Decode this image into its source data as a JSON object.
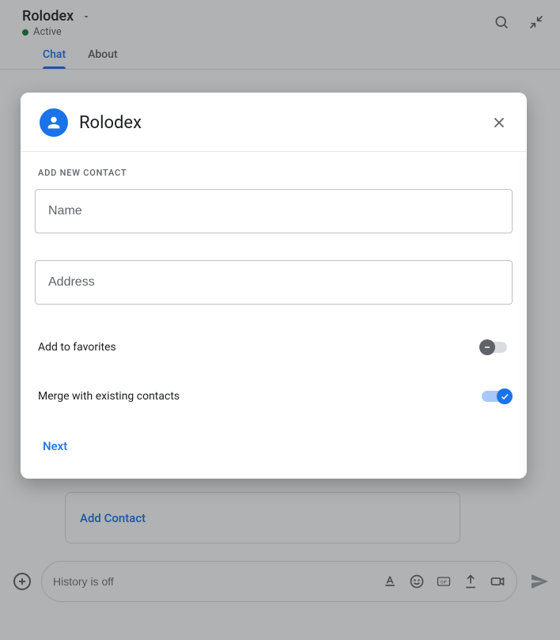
{
  "header": {
    "title": "Rolodex",
    "status": "Active",
    "tabs": [
      {
        "label": "Chat",
        "active": true
      },
      {
        "label": "About",
        "active": false
      }
    ]
  },
  "suggestion": {
    "link_label": "Add Contact"
  },
  "composer": {
    "placeholder": "History is off"
  },
  "dialog": {
    "title": "Rolodex",
    "section_label": "ADD NEW CONTACT",
    "name_placeholder": "Name",
    "name_value": "",
    "address_placeholder": "Address",
    "address_value": "",
    "favorites_label": "Add to favorites",
    "favorites_on": false,
    "merge_label": "Merge with existing contacts",
    "merge_on": true,
    "next_label": "Next"
  },
  "icons": {
    "dropdown": "chevron-down",
    "search": "search",
    "collapse": "collapse",
    "plus": "plus-circle",
    "format": "text-format",
    "emoji": "emoji",
    "gif": "gif",
    "upload": "upload",
    "video": "video",
    "send": "send",
    "person": "person",
    "close": "close",
    "minus": "minus",
    "check": "check"
  }
}
